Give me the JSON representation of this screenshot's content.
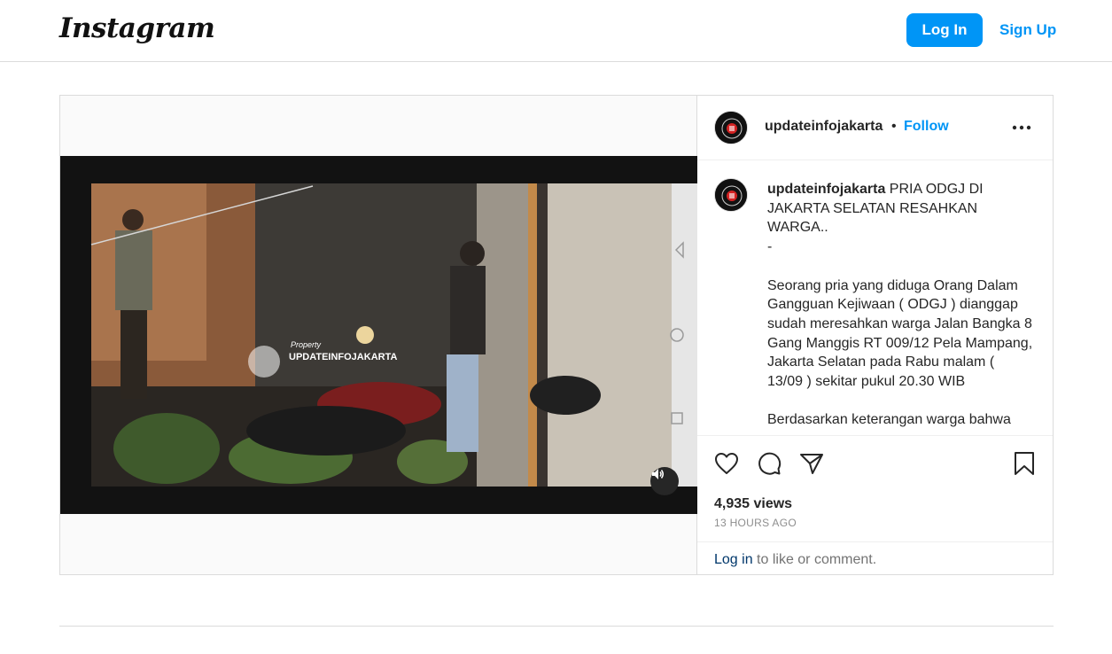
{
  "header": {
    "logo": "Instagram",
    "login_label": "Log In",
    "signup_label": "Sign Up"
  },
  "post": {
    "username": "updateinfojakarta",
    "separator": "•",
    "follow_label": "Follow",
    "caption_username": "updateinfojakarta",
    "caption_text": " PRIA ODGJ DI JAKARTA SELATAN RESAHKAN WARGA..\n-\n\nSeorang pria yang diduga Orang Dalam Gangguan Kejiwaan ( ODGJ ) dianggap sudah meresahkan warga Jalan Bangka 8 Gang Manggis RT 009/12 Pela Mampang, Jakarta Selatan pada Rabu malam ( 13/09 ) sekitar pukul 20.30 WIB\n\nBerdasarkan keterangan warga bahwa",
    "views": "4,935 views",
    "time_ago": "13 HOURS AGO",
    "login_link": "Log in",
    "login_suffix": " to like or comment.",
    "watermark_small": "Property",
    "watermark_main": "UPDATEINFOJAKARTA"
  },
  "icons": [
    "heart-icon",
    "comment-icon",
    "share-icon",
    "bookmark-icon",
    "more-icon",
    "speaker-icon"
  ],
  "colors": {
    "accent": "#0095f6",
    "link_dark": "#00376b",
    "border": "#dbdbdb"
  }
}
